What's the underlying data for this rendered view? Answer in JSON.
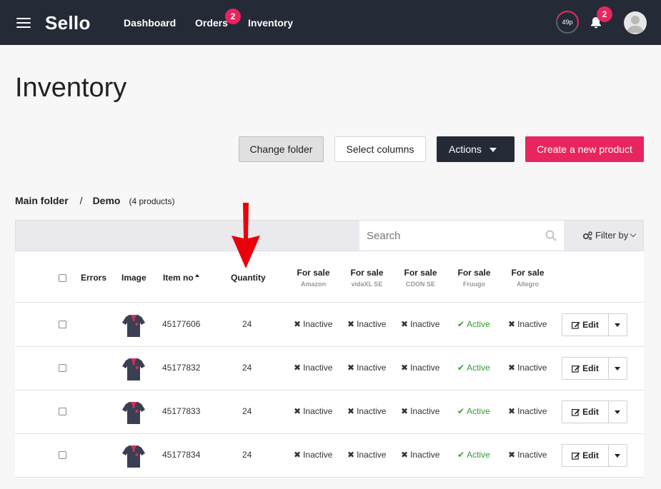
{
  "nav": {
    "logo": "Sello",
    "links": {
      "dashboard": "Dashboard",
      "orders": "Orders",
      "inventory": "Inventory"
    },
    "orders_badge": "2",
    "timer": "49p",
    "notifications_badge": "2"
  },
  "page": {
    "title": "Inventory"
  },
  "toolbar": {
    "change_folder": "Change folder",
    "select_columns": "Select columns",
    "actions": "Actions",
    "create_product": "Create a new product"
  },
  "breadcrumb": {
    "root": "Main folder",
    "sep": "/",
    "current": "Demo",
    "count": "(4 products)"
  },
  "search": {
    "placeholder": "Search",
    "filter_label": "Filter by"
  },
  "table": {
    "headers": {
      "errors": "Errors",
      "image": "Image",
      "item_no": "Item no",
      "quantity": "Quantity",
      "channels": [
        {
          "label": "For sale",
          "sub": "Amazon"
        },
        {
          "label": "For sale",
          "sub": "vidaXL SE"
        },
        {
          "label": "For sale",
          "sub": "CDON SE"
        },
        {
          "label": "For sale",
          "sub": "Fruugo"
        },
        {
          "label": "For sale",
          "sub": "Allegro"
        }
      ]
    },
    "edit_label": "Edit",
    "rows": [
      {
        "item_no": "45177606",
        "quantity": "24",
        "statuses": [
          "Inactive",
          "Inactive",
          "Inactive",
          "Active",
          "Inactive"
        ]
      },
      {
        "item_no": "45177832",
        "quantity": "24",
        "statuses": [
          "Inactive",
          "Inactive",
          "Inactive",
          "Active",
          "Inactive"
        ]
      },
      {
        "item_no": "45177833",
        "quantity": "24",
        "statuses": [
          "Inactive",
          "Inactive",
          "Inactive",
          "Active",
          "Inactive"
        ]
      },
      {
        "item_no": "45177834",
        "quantity": "24",
        "statuses": [
          "Inactive",
          "Inactive",
          "Inactive",
          "Active",
          "Inactive"
        ]
      }
    ]
  },
  "colors": {
    "nav_bg": "#252a37",
    "accent": "#e8255f",
    "active_green": "#2f9e2f",
    "annotation_red": "#e8000b"
  },
  "annotation": {
    "icon": "red-arrow-down-icon"
  }
}
